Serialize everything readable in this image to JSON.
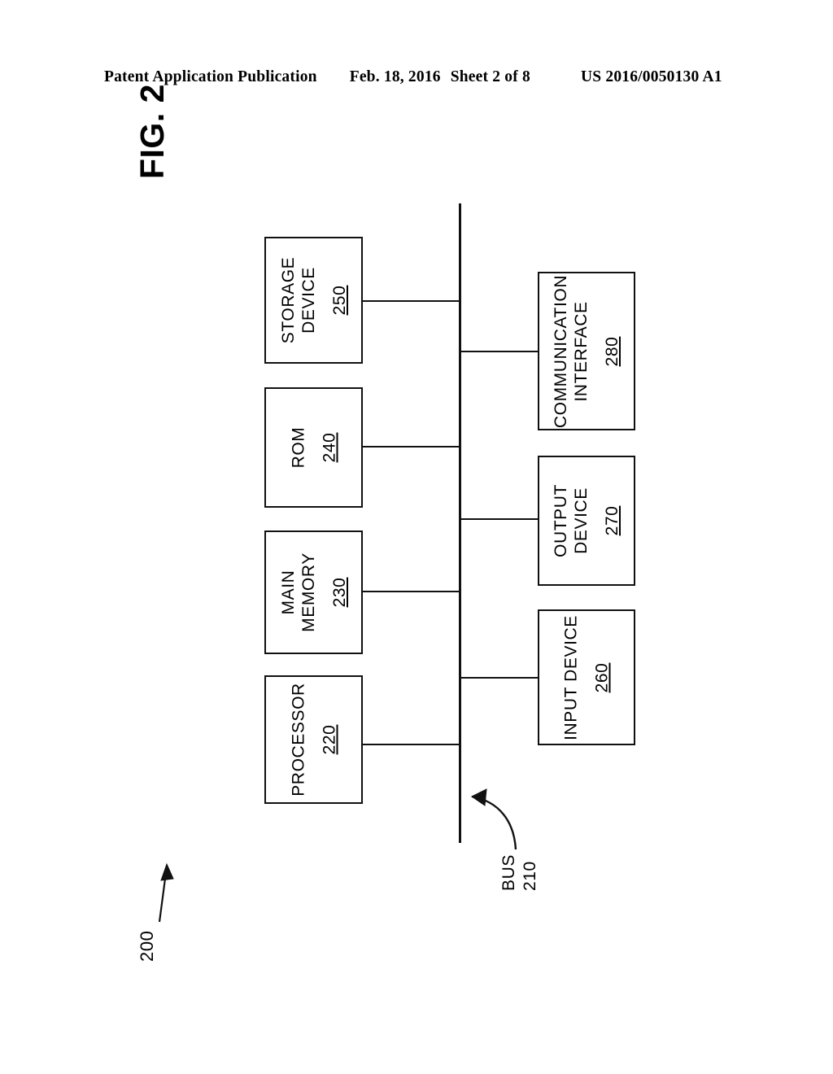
{
  "header": {
    "publication": "Patent Application Publication",
    "date": "Feb. 18, 2016",
    "sheet": "Sheet 2 of 8",
    "patent_number": "US 2016/0050130 A1"
  },
  "figure": {
    "title": "FIG. 2",
    "system_ref": "200",
    "bus": {
      "label": "BUS",
      "ref": "210"
    },
    "nodes": [
      {
        "id": "processor",
        "label_lines": [
          "PROCESSOR"
        ],
        "ref": "220",
        "column": "left"
      },
      {
        "id": "main-memory",
        "label_lines": [
          "MAIN",
          "MEMORY"
        ],
        "ref": "230",
        "column": "left"
      },
      {
        "id": "rom",
        "label_lines": [
          "ROM"
        ],
        "ref": "240",
        "column": "left"
      },
      {
        "id": "storage",
        "label_lines": [
          "STORAGE",
          "DEVICE"
        ],
        "ref": "250",
        "column": "left"
      },
      {
        "id": "input",
        "label_lines": [
          "INPUT DEVICE"
        ],
        "ref": "260",
        "column": "right"
      },
      {
        "id": "output",
        "label_lines": [
          "OUTPUT",
          "DEVICE"
        ],
        "ref": "270",
        "column": "right"
      },
      {
        "id": "comm",
        "label_lines": [
          "COMMUNICATION",
          "INTERFACE"
        ],
        "ref": "280",
        "column": "right"
      }
    ]
  },
  "colors": {
    "ink": "#111111",
    "paper": "#ffffff"
  }
}
